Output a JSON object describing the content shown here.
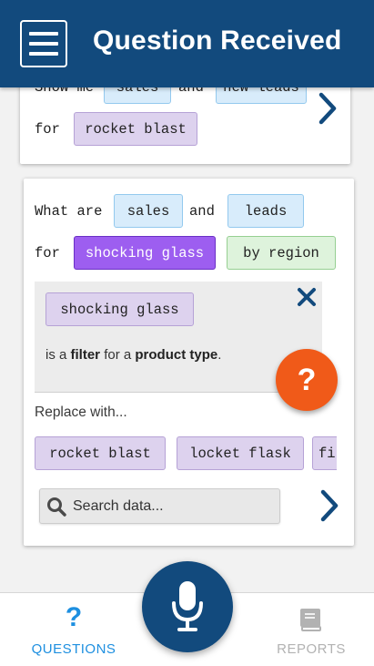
{
  "header": {
    "title": "Question Received",
    "menu_icon": "hamburger-menu-icon",
    "background": "#124a7d"
  },
  "previous_question": {
    "line1": {
      "words": [
        "Show me",
        "and"
      ],
      "chips": [
        "sales",
        "new leads"
      ]
    },
    "line2": {
      "word": "for",
      "chip": "rocket blast"
    }
  },
  "current_question": {
    "line1": {
      "word1": "What are",
      "chip1": "sales",
      "word2": "and",
      "chip2": "leads"
    },
    "line2": {
      "word": "for",
      "active_chip": "shocking glass",
      "chip": "by region"
    }
  },
  "filter_panel": {
    "chip": "shocking glass",
    "text_pre": "is a ",
    "text_bold1": "filter",
    "text_mid": " for a ",
    "text_bold2": "product type",
    "text_post": "."
  },
  "replace": {
    "label": "Replace with...",
    "options": [
      "rocket blast",
      "locket flask",
      "fi"
    ]
  },
  "search": {
    "placeholder": "Search data..."
  },
  "help_button": {
    "label": "?",
    "color": "#f05a19"
  },
  "bottom_nav": {
    "tabs": [
      {
        "label": "QUESTIONS",
        "icon": "question-mark-icon",
        "active": true
      },
      {
        "label": "REPORTS",
        "icon": "book-icon",
        "active": false
      }
    ],
    "active_color": "#1d8fe0"
  },
  "mic_button": {
    "icon": "microphone-icon"
  }
}
